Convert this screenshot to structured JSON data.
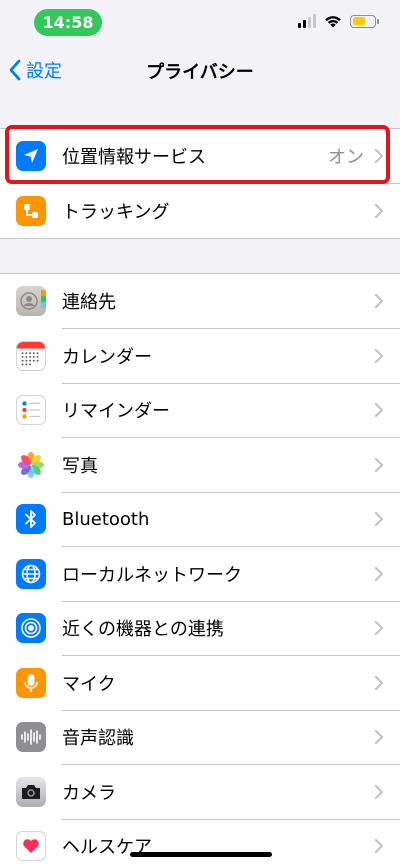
{
  "status_bar": {
    "time": "14:58",
    "battery_color": "#ffcc00",
    "pill_color": "#34c759"
  },
  "nav": {
    "back_label": "設定",
    "title": "プライバシー"
  },
  "highlight_color": "#e6131b",
  "group1": [
    {
      "label": "位置情報サービス",
      "value": "オン",
      "icon": "location-arrow-icon"
    },
    {
      "label": "トラッキング",
      "value": "",
      "icon": "tracking-icon"
    }
  ],
  "group2": [
    {
      "label": "連絡先",
      "icon": "contacts-icon"
    },
    {
      "label": "カレンダー",
      "icon": "calendar-icon"
    },
    {
      "label": "リマインダー",
      "icon": "reminders-icon"
    },
    {
      "label": "写真",
      "icon": "photos-icon"
    },
    {
      "label": "Bluetooth",
      "icon": "bluetooth-icon"
    },
    {
      "label": "ローカルネットワーク",
      "icon": "globe-icon"
    },
    {
      "label": "近くの機器との連携",
      "icon": "nearby-interaction-icon"
    },
    {
      "label": "マイク",
      "icon": "microphone-icon"
    },
    {
      "label": "音声認識",
      "icon": "speech-recognition-icon"
    },
    {
      "label": "カメラ",
      "icon": "camera-icon"
    },
    {
      "label": "ヘルスケア",
      "icon": "health-icon"
    }
  ]
}
